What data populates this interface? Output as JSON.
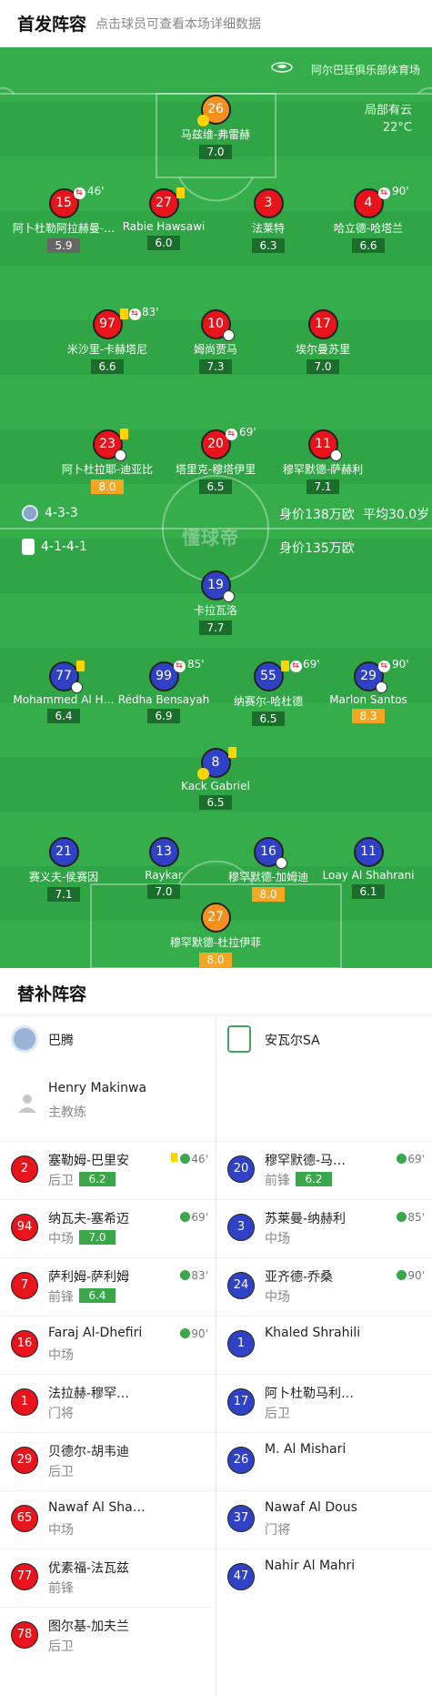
{
  "header": {
    "title": "首发阵容",
    "subtitle": "点击球员可查看本场详细数据"
  },
  "pitch": {
    "venue": "阿尔巴廷俱乐部体育场",
    "weather": "局部有云",
    "temperature": "22°C",
    "watermark": "懂球帝",
    "home": {
      "formation": "4-3-3",
      "value": "身价138万欧",
      "avg_age": "平均30.0岁",
      "color": "#e8141b"
    },
    "away": {
      "formation": "4-1-4-1",
      "value": "身价135万欧",
      "color": "#2f42c6"
    }
  },
  "home_players": [
    {
      "num": "26",
      "name": "马兹维-弗雷赫",
      "rating": "7.0",
      "captain": "c"
    },
    {
      "num": "15",
      "name": "阿卜杜勒阿拉赫曼-…",
      "rating": "5.9",
      "sub_min": "46'"
    },
    {
      "num": "27",
      "name": "Rabie Hawsawi",
      "rating": "6.0"
    },
    {
      "num": "3",
      "name": "法莱特",
      "rating": "6.3"
    },
    {
      "num": "4",
      "name": "哈立德-哈塔兰",
      "rating": "6.6",
      "sub_min": "90'"
    },
    {
      "num": "97",
      "name": "米沙里-卡赫塔尼",
      "rating": "6.6",
      "sub_min": "83'"
    },
    {
      "num": "10",
      "name": "姆尚贾马",
      "rating": "7.3"
    },
    {
      "num": "17",
      "name": "埃尔曼苏里",
      "rating": "7.0"
    },
    {
      "num": "23",
      "name": "阿卜杜拉耶-迪亚比",
      "rating": "8.0"
    },
    {
      "num": "20",
      "name": "塔里克-穆塔伊里",
      "rating": "6.5",
      "sub_min": "69'"
    },
    {
      "num": "11",
      "name": "穆罕默德-萨赫利",
      "rating": "7.1"
    }
  ],
  "away_players": [
    {
      "num": "19",
      "name": "卡拉瓦洛",
      "rating": "7.7"
    },
    {
      "num": "77",
      "name": "Mohammed Al H…",
      "rating": "6.4"
    },
    {
      "num": "99",
      "name": "Rédha Bensayah",
      "rating": "6.9",
      "sub_min": "85'"
    },
    {
      "num": "55",
      "name": "纳赛尔-哈杜德",
      "rating": "6.5",
      "sub_min": "69'"
    },
    {
      "num": "29",
      "name": "Marlon Santos",
      "rating": "8.3",
      "sub_min": "90'"
    },
    {
      "num": "8",
      "name": "Kack Gabriel",
      "rating": "6.5",
      "captain": "c"
    },
    {
      "num": "21",
      "name": "赛义夫-侯赛因",
      "rating": "7.1"
    },
    {
      "num": "13",
      "name": "Raykar",
      "rating": "7.0"
    },
    {
      "num": "16",
      "name": "穆罕默德-加姆迪",
      "rating": "8.0"
    },
    {
      "num": "11",
      "name": "Loay Al Shahrani",
      "rating": "6.1"
    },
    {
      "num": "27",
      "name": "穆罕默德-杜拉伊菲",
      "rating": "8.0"
    }
  ],
  "subs": {
    "title": "替补阵容",
    "home_team": "巴腾",
    "away_team": "安瓦尔SA",
    "coach": {
      "name": "Henry Makinwa",
      "role": "主教练"
    },
    "home": [
      {
        "num": "2",
        "name": "塞勒姆-巴里安",
        "pos": "后卫",
        "rating": "6.2",
        "min": "46'"
      },
      {
        "num": "94",
        "name": "纳瓦夫-塞希迈",
        "pos": "中场",
        "rating": "7.0",
        "min": "69'"
      },
      {
        "num": "7",
        "name": "萨利姆-萨利姆",
        "pos": "前锋",
        "rating": "6.4",
        "min": "83'"
      },
      {
        "num": "16",
        "name": "Faraj Al-Dhefiri",
        "pos": "中场",
        "min": "90'"
      },
      {
        "num": "1",
        "name": "法拉赫-穆罕…",
        "pos": "门将"
      },
      {
        "num": "29",
        "name": "贝德尔-胡韦迪",
        "pos": "后卫"
      },
      {
        "num": "65",
        "name": "Nawaf Al Sha…",
        "pos": "中场"
      },
      {
        "num": "77",
        "name": "优素福-法瓦兹",
        "pos": "前锋"
      },
      {
        "num": "78",
        "name": "图尔基-加夫兰",
        "pos": "后卫"
      }
    ],
    "away": [
      {
        "num": "20",
        "name": "穆罕默德-马…",
        "pos": "前锋",
        "rating": "6.2",
        "min": "69'"
      },
      {
        "num": "3",
        "name": "苏莱曼-纳赫利",
        "pos": "中场",
        "min": "85'"
      },
      {
        "num": "24",
        "name": "亚齐德-乔桑",
        "pos": "中场",
        "min": "90'"
      },
      {
        "num": "1",
        "name": "Khaled Shrahili",
        "pos": ""
      },
      {
        "num": "17",
        "name": "阿卜杜勒马利…",
        "pos": "后卫"
      },
      {
        "num": "26",
        "name": "M. Al Mishari",
        "pos": ""
      },
      {
        "num": "37",
        "name": "Nawaf Al Dous",
        "pos": "门将"
      },
      {
        "num": "47",
        "name": "Nahir Al Mahri",
        "pos": ""
      }
    ]
  }
}
